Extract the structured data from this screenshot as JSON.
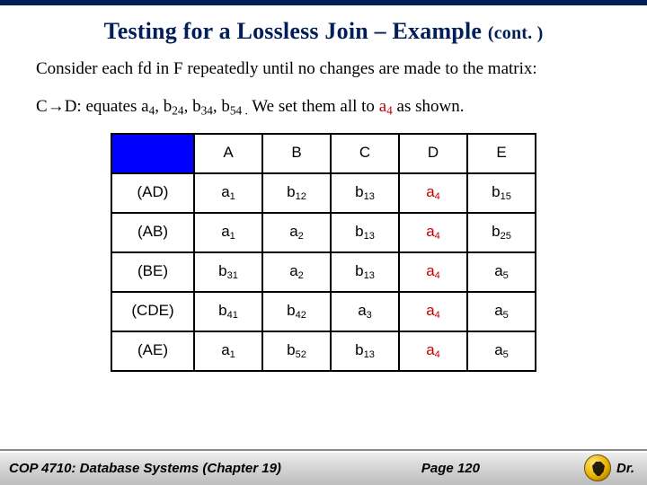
{
  "header": {
    "title_main": "Testing for a Lossless Join – Example",
    "title_cont": "(cont. )"
  },
  "body": {
    "line1": "Consider each fd in F repeatedly until no changes are made to the matrix:",
    "fd_lhs": "C",
    "fd_arrow": "→",
    "fd_rhs": "D",
    "equates_prefix": ": equates a",
    "equates_s1": "4",
    "equates_c1": ", b",
    "equates_s2": "24",
    "equates_c2": ", b",
    "equates_s3": "34",
    "equates_c3": ", b",
    "equates_s4": "54 .",
    "set_text_1": "  We set them all to ",
    "set_text_red_a": "a",
    "set_text_red_sub": "4",
    "set_text_2": " as shown."
  },
  "table": {
    "cols": [
      "A",
      "B",
      "C",
      "D",
      "E"
    ],
    "rows": [
      {
        "name": "(AD)",
        "cells": [
          {
            "v": "a",
            "s": "1"
          },
          {
            "v": "b",
            "s": "12"
          },
          {
            "v": "b",
            "s": "13"
          },
          {
            "v": "a",
            "s": "4",
            "red": true
          },
          {
            "v": "b",
            "s": "15"
          }
        ]
      },
      {
        "name": "(AB)",
        "cells": [
          {
            "v": "a",
            "s": "1"
          },
          {
            "v": "a",
            "s": "2"
          },
          {
            "v": "b",
            "s": "13"
          },
          {
            "v": "a",
            "s": "4",
            "red": true
          },
          {
            "v": "b",
            "s": "25"
          }
        ]
      },
      {
        "name": "(BE)",
        "cells": [
          {
            "v": "b",
            "s": "31"
          },
          {
            "v": "a",
            "s": "2"
          },
          {
            "v": "b",
            "s": "13"
          },
          {
            "v": "a",
            "s": "4",
            "red": true
          },
          {
            "v": "a",
            "s": "5"
          }
        ]
      },
      {
        "name": "(CDE)",
        "cells": [
          {
            "v": "b",
            "s": "41"
          },
          {
            "v": "b",
            "s": "42"
          },
          {
            "v": "a",
            "s": "3"
          },
          {
            "v": "a",
            "s": "4",
            "red": true
          },
          {
            "v": "a",
            "s": "5"
          }
        ]
      },
      {
        "name": "(AE)",
        "cells": [
          {
            "v": "a",
            "s": "1"
          },
          {
            "v": "b",
            "s": "52"
          },
          {
            "v": "b",
            "s": "13"
          },
          {
            "v": "a",
            "s": "4",
            "red": true
          },
          {
            "v": "a",
            "s": "5"
          }
        ]
      }
    ]
  },
  "footer": {
    "course": "COP 4710: Database Systems  (Chapter 19)",
    "page": "Page 120",
    "author": "Dr."
  }
}
